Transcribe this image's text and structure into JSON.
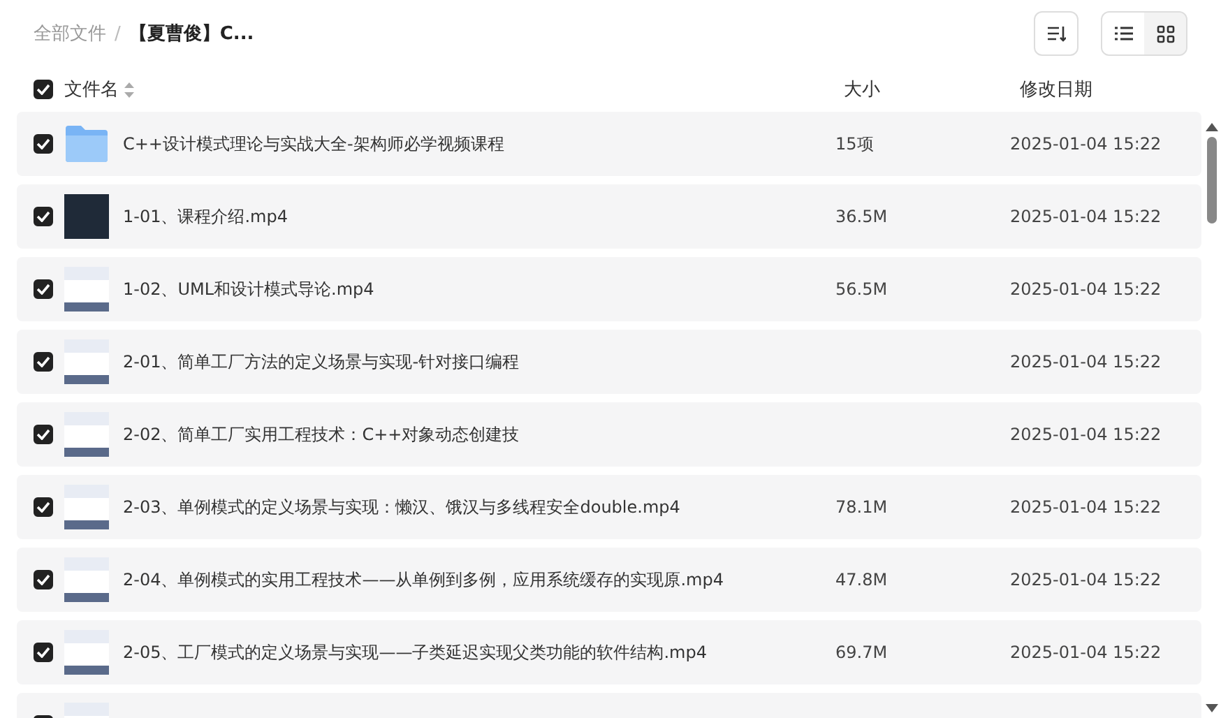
{
  "breadcrumb": {
    "separator": "/",
    "items": [
      {
        "label": "全部文件",
        "current": false
      },
      {
        "label": "【夏曹俊】C...",
        "current": true
      }
    ]
  },
  "header": {
    "checked": true,
    "columns": [
      "文件名",
      "大小",
      "修改日期"
    ]
  },
  "rows": [
    {
      "kind": "folder",
      "checked": true,
      "name": "C++设计模式理论与实战大全-架构师必学视频课程",
      "size": "15项",
      "date": "2025-01-04 15:22"
    },
    {
      "kind": "video",
      "checked": true,
      "name": "1-01、课程介绍.mp4",
      "size": "36.5M",
      "date": "2025-01-04 15:22"
    },
    {
      "kind": "video",
      "checked": true,
      "name": "1-02、UML和设计模式导论.mp4",
      "size": "56.5M",
      "date": "2025-01-04 15:22"
    },
    {
      "kind": "video",
      "checked": true,
      "name": "2-01、简单工厂方法的定义场景与实现-针对接口编程",
      "date": "2025-01-04 15:22"
    },
    {
      "kind": "video",
      "checked": true,
      "name": "2-02、简单工厂实用工程技术：C++对象动态创建技",
      "date": "2025-01-04 15:22"
    },
    {
      "kind": "video",
      "checked": true,
      "name": "2-03、单例模式的定义场景与实现：懒汉、饿汉与多线程安全double.mp4",
      "size": "78.1M",
      "date": "2025-01-04 15:22"
    },
    {
      "kind": "video",
      "checked": true,
      "name": "2-04、单例模式的实用工程技术——从单例到多例，应用系统缓存的实现原.mp4",
      "size": "47.8M",
      "date": "2025-01-04 15:22"
    },
    {
      "kind": "video",
      "checked": true,
      "name": "2-05、工厂模式的定义场景与实现——子类延迟实现父类功能的软件结构.mp4",
      "size": "69.7M",
      "date": "2025-01-04 15:22"
    },
    {
      "kind": "video",
      "checked": true
    }
  ],
  "view_buttons": [
    {
      "kind": "list",
      "selected": true
    },
    {
      "kind": "grid",
      "selected": false
    }
  ]
}
